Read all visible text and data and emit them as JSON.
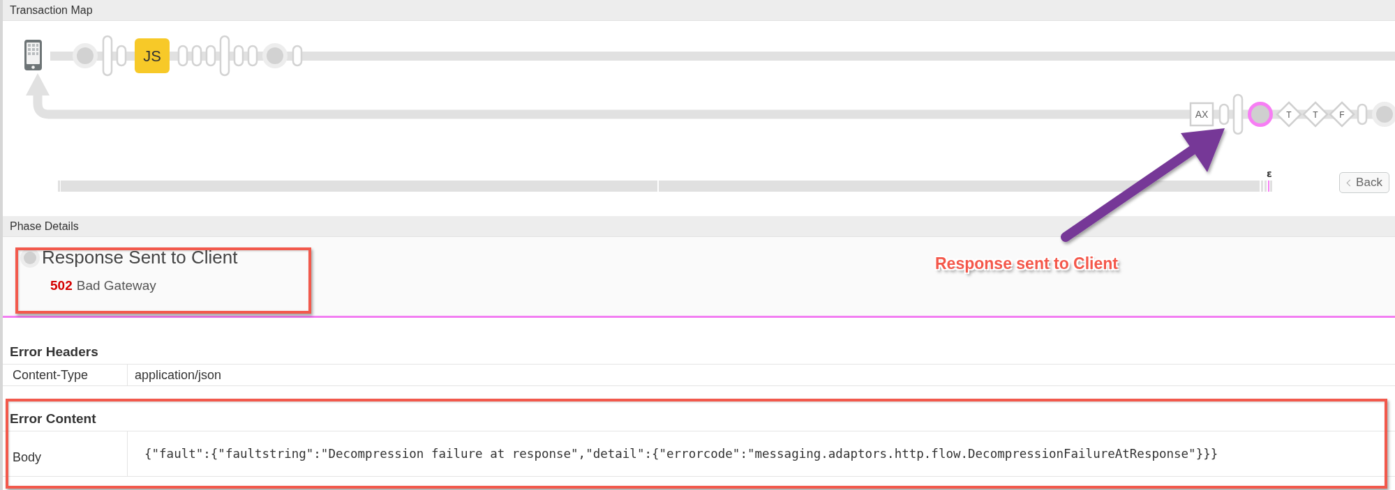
{
  "map": {
    "title": "Transaction Map",
    "request_nodes": [
      {
        "kind": "circle",
        "selected": false
      },
      {
        "kind": "tall",
        "selected": false
      },
      {
        "kind": "pill",
        "selected": false
      },
      {
        "kind": "js",
        "label": "JS",
        "selected": false
      },
      {
        "kind": "pill",
        "selected": false
      },
      {
        "kind": "pill",
        "selected": false
      },
      {
        "kind": "pill",
        "selected": false
      },
      {
        "kind": "tall",
        "selected": false
      },
      {
        "kind": "pill",
        "selected": false
      },
      {
        "kind": "pill",
        "selected": false
      },
      {
        "kind": "circle",
        "selected": false
      },
      {
        "kind": "pill",
        "selected": false
      }
    ],
    "response_nodes": [
      {
        "kind": "ax",
        "label": "AX",
        "selected": false
      },
      {
        "kind": "pill",
        "selected": false
      },
      {
        "kind": "tall",
        "selected": false
      },
      {
        "kind": "circle",
        "selected": true
      },
      {
        "kind": "diamond",
        "label": "T",
        "selected": false
      },
      {
        "kind": "diamond",
        "label": "T",
        "selected": false
      },
      {
        "kind": "diamond",
        "label": "F",
        "selected": false
      },
      {
        "kind": "pill",
        "selected": false
      },
      {
        "kind": "circle",
        "selected": false
      }
    ],
    "timeline_marker": "ε",
    "back_button": "Back"
  },
  "phase": {
    "title": "Phase Details",
    "name": "Response Sent to Client",
    "status_code": "502",
    "status_text": "Bad Gateway"
  },
  "error_headers": {
    "title": "Error Headers",
    "rows": [
      {
        "name": "Content-Type",
        "value": "application/json"
      }
    ]
  },
  "error_content": {
    "title": "Error Content",
    "rows": [
      {
        "name": "Body",
        "value": "{\"fault\":{\"faultstring\":\"Decompression failure at response\",\"detail\":{\"errorcode\":\"messaging.adaptors.http.flow.DecompressionFailureAtResponse\"}}}"
      }
    ]
  },
  "annotation": {
    "label": "Response sent to Client"
  }
}
